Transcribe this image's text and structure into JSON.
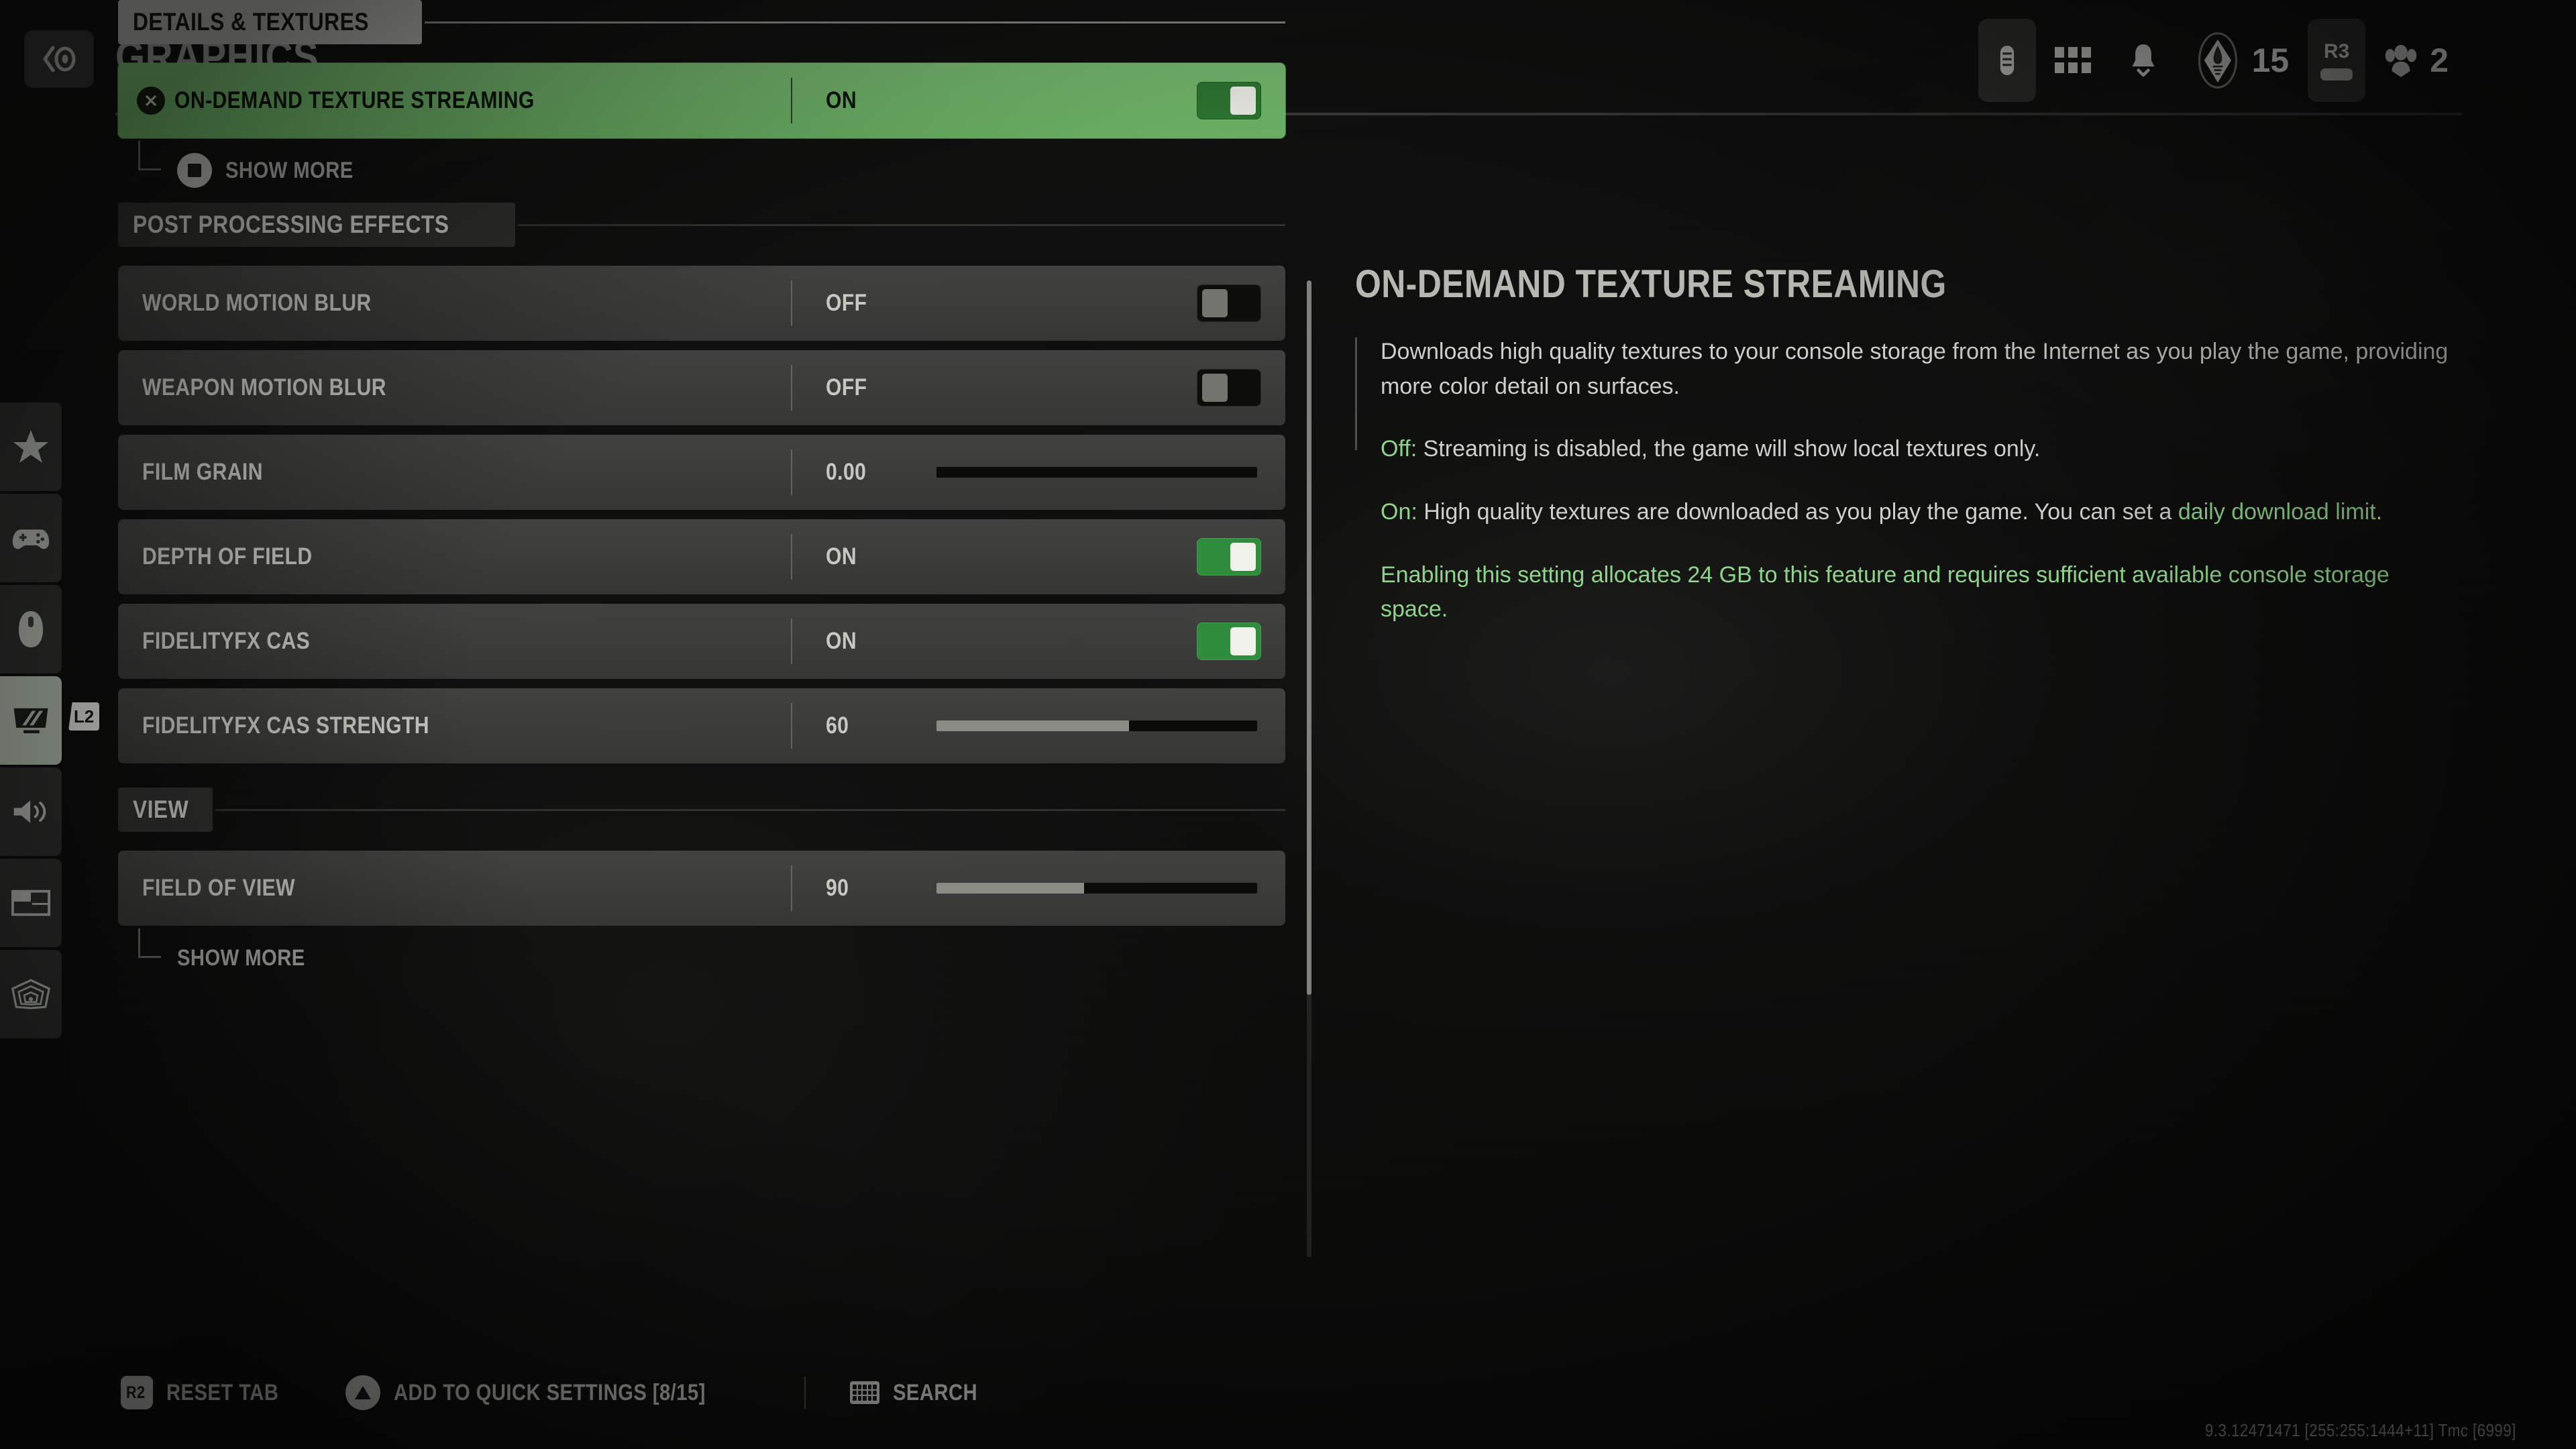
{
  "header": {
    "back_icon": "back-chevron-circle-icon",
    "title": "GRAPHICS",
    "right_items": [
      {
        "icon": "battery-capsule-icon",
        "label": ""
      },
      {
        "icon": "grid-apps-icon",
        "label": ""
      },
      {
        "icon": "bell-notification-icon",
        "label": ""
      },
      {
        "icon": "rank-emblem-icon",
        "label": "15"
      },
      {
        "icon": "r3-button-icon",
        "label": "R3"
      },
      {
        "icon": "squad-players-icon",
        "label": "2"
      }
    ]
  },
  "rail": {
    "badge": "L2",
    "items": [
      {
        "name": "favorites",
        "icon": "star-icon",
        "active": false
      },
      {
        "name": "controller",
        "icon": "gamepad-icon",
        "active": false
      },
      {
        "name": "mouse-keyboard",
        "icon": "mouse-icon",
        "active": false
      },
      {
        "name": "graphics",
        "icon": "monitor-icon",
        "active": true
      },
      {
        "name": "audio",
        "icon": "speaker-icon",
        "active": false
      },
      {
        "name": "interface",
        "icon": "panels-icon",
        "active": false
      },
      {
        "name": "accessibility",
        "icon": "radar-icon",
        "active": false
      }
    ]
  },
  "settings": {
    "sections": [
      {
        "title": "DETAILS & TEXTURES",
        "style": "bright",
        "rows": [
          {
            "label": "ON-DEMAND TEXTURE STREAMING",
            "value": "ON",
            "control": "toggle",
            "toggle_state": "on",
            "selected": true,
            "prefix_icon": "cross-button-icon"
          }
        ],
        "show_more": {
          "label": "SHOW MORE",
          "button_icon": "square-button-icon"
        }
      },
      {
        "title": "POST PROCESSING EFFECTS",
        "style": "dim",
        "rows": [
          {
            "label": "WORLD MOTION BLUR",
            "value": "OFF",
            "control": "toggle",
            "toggle_state": "off",
            "selected": false
          },
          {
            "label": "WEAPON MOTION BLUR",
            "value": "OFF",
            "control": "toggle",
            "toggle_state": "off",
            "selected": false
          },
          {
            "label": "FILM GRAIN",
            "value": "0.00",
            "control": "slider",
            "slider_percent": 0,
            "selected": false
          },
          {
            "label": "DEPTH OF FIELD",
            "value": "ON",
            "control": "toggle",
            "toggle_state": "on",
            "selected": false
          },
          {
            "label": "FIDELITYFX CAS",
            "value": "ON",
            "control": "toggle",
            "toggle_state": "on",
            "selected": false
          },
          {
            "label": "FIDELITYFX CAS STRENGTH",
            "value": "60",
            "control": "slider",
            "slider_percent": 60,
            "selected": false
          }
        ],
        "show_more": null
      },
      {
        "title": "VIEW",
        "style": "dim",
        "rows": [
          {
            "label": "FIELD OF VIEW",
            "value": "90",
            "control": "slider",
            "slider_percent": 46,
            "selected": false
          }
        ],
        "show_more": {
          "label": "SHOW MORE",
          "button_icon": null
        }
      }
    ]
  },
  "detail": {
    "title": "ON-DEMAND TEXTURE STREAMING",
    "paragraphs": [
      {
        "kind": "plain",
        "text": "Downloads high quality textures to your console storage from the Internet as you play the game, providing more color detail on surfaces."
      },
      {
        "kind": "lead",
        "lead": "Off:",
        "text": " Streaming is disabled, the game will show local textures only."
      },
      {
        "kind": "lead-link",
        "lead": "On:",
        "text": " High quality textures are downloaded as you play the game. You can set a ",
        "link": "daily download limit",
        "tail": "."
      },
      {
        "kind": "green",
        "text": "Enabling this setting allocates 24 GB to this feature and requires sufficient available console storage space."
      }
    ]
  },
  "footer": {
    "items": [
      {
        "button": "R2",
        "icon": "r2-button-icon",
        "label": "RESET TAB"
      },
      {
        "button": "TRI",
        "icon": "triangle-button-icon",
        "label": "ADD TO QUICK SETTINGS [8/15]"
      },
      {
        "button": "KBD",
        "icon": "keyboard-icon",
        "label": "SEARCH"
      }
    ]
  },
  "version": "9.3.12471471 [255:255:1444+11] Tmc [6999]",
  "colors": {
    "accent_green": "#7cc275",
    "text_green": "#8fd48c",
    "row_bg": "#454543",
    "panel_text": "#cfcfc9"
  }
}
